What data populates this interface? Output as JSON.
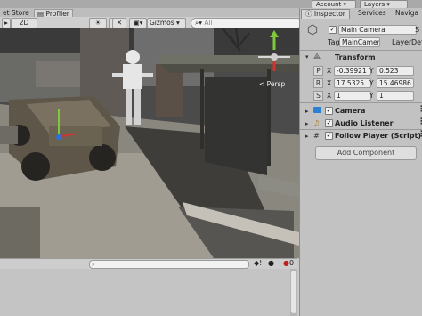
{
  "topbar": {
    "account_label": "Account",
    "layers_label": "Layers"
  },
  "tabs": [
    {
      "label": "et Store"
    },
    {
      "label": "Profiler"
    }
  ],
  "scene_toolbar": {
    "mode_2d": "2D",
    "gizmos_label": "Gizmos",
    "search_placeholder": "All"
  },
  "scene": {
    "persp_label": "< Persp"
  },
  "console": {
    "search_placeholder": "",
    "error_count": "0"
  },
  "inspector": {
    "tabs": [
      {
        "label": "Inspector"
      },
      {
        "label": "Services"
      },
      {
        "label": "Naviga"
      }
    ],
    "object_name": "Main Camera",
    "static_label": "S",
    "tag_label": "Tag",
    "tag_value": "MainCamer",
    "layer_label": "Layer",
    "layer_value": "Def",
    "transform": {
      "title": "Transform",
      "position_label": "P",
      "position": {
        "x": "-0.39921",
        "y": "0.523"
      },
      "rotation_label": "R",
      "rotation": {
        "x": "17.5325",
        "y": "15.46986"
      },
      "scale_label": "S",
      "scale": {
        "x": "1",
        "y": "1"
      }
    },
    "components": [
      {
        "name": "Camera"
      },
      {
        "name": "Audio Listener"
      },
      {
        "name": "Follow Player (Script)"
      }
    ],
    "add_component_label": "Add Component"
  },
  "colors": {
    "scene_sky": "#3c3c3c",
    "gizmo_green": "#7ec83a",
    "gizmo_red": "#d0342c",
    "gizmo_blue": "#2f6fd6",
    "camera_icon": "#2d7fd3"
  }
}
